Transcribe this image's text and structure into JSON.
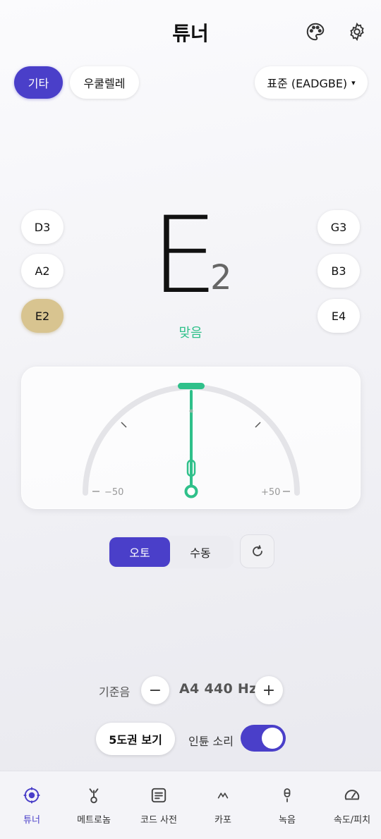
{
  "header": {
    "title": "튜너"
  },
  "instruments": [
    {
      "label": "기타",
      "active": true
    },
    {
      "label": "우쿨렐레",
      "active": false
    }
  ],
  "tuning_preset": {
    "label": "표준 (EADGBE)",
    "arrow": "▾"
  },
  "strings_left": [
    "D3",
    "A2",
    "E2"
  ],
  "strings_right": [
    "G3",
    "B3",
    "E4"
  ],
  "selected_string": "E2",
  "note": {
    "letter": "E",
    "octave": "2"
  },
  "status": "맞음",
  "meter": {
    "min_label": "−50",
    "max_label": "+50",
    "cents": 0,
    "needle_color": "#2fc08a"
  },
  "mode": {
    "auto_label": "오토",
    "manual_label": "수동",
    "selected": "auto"
  },
  "reference": {
    "label": "기준음",
    "minus": "−",
    "plus": "+",
    "value": "A4 440 Hz"
  },
  "circle_of_fifths": "5도권 보기",
  "tuning_sound": {
    "label": "인튠 소리",
    "on": true
  },
  "tabs": [
    {
      "label": "튜너",
      "icon": "tuner-icon",
      "active": true
    },
    {
      "label": "메트로놈",
      "icon": "metronome-icon",
      "active": false
    },
    {
      "label": "코드 사전",
      "icon": "chord-dictionary-icon",
      "active": false
    },
    {
      "label": "카포",
      "icon": "capo-icon",
      "active": false
    },
    {
      "label": "녹음",
      "icon": "microphone-icon",
      "active": false
    },
    {
      "label": "속도/피치",
      "icon": "speedometer-icon",
      "active": false
    }
  ],
  "colors": {
    "accent": "#4a3fc9",
    "in_tune": "#2fc08a",
    "selected_string": "#d8c490"
  }
}
